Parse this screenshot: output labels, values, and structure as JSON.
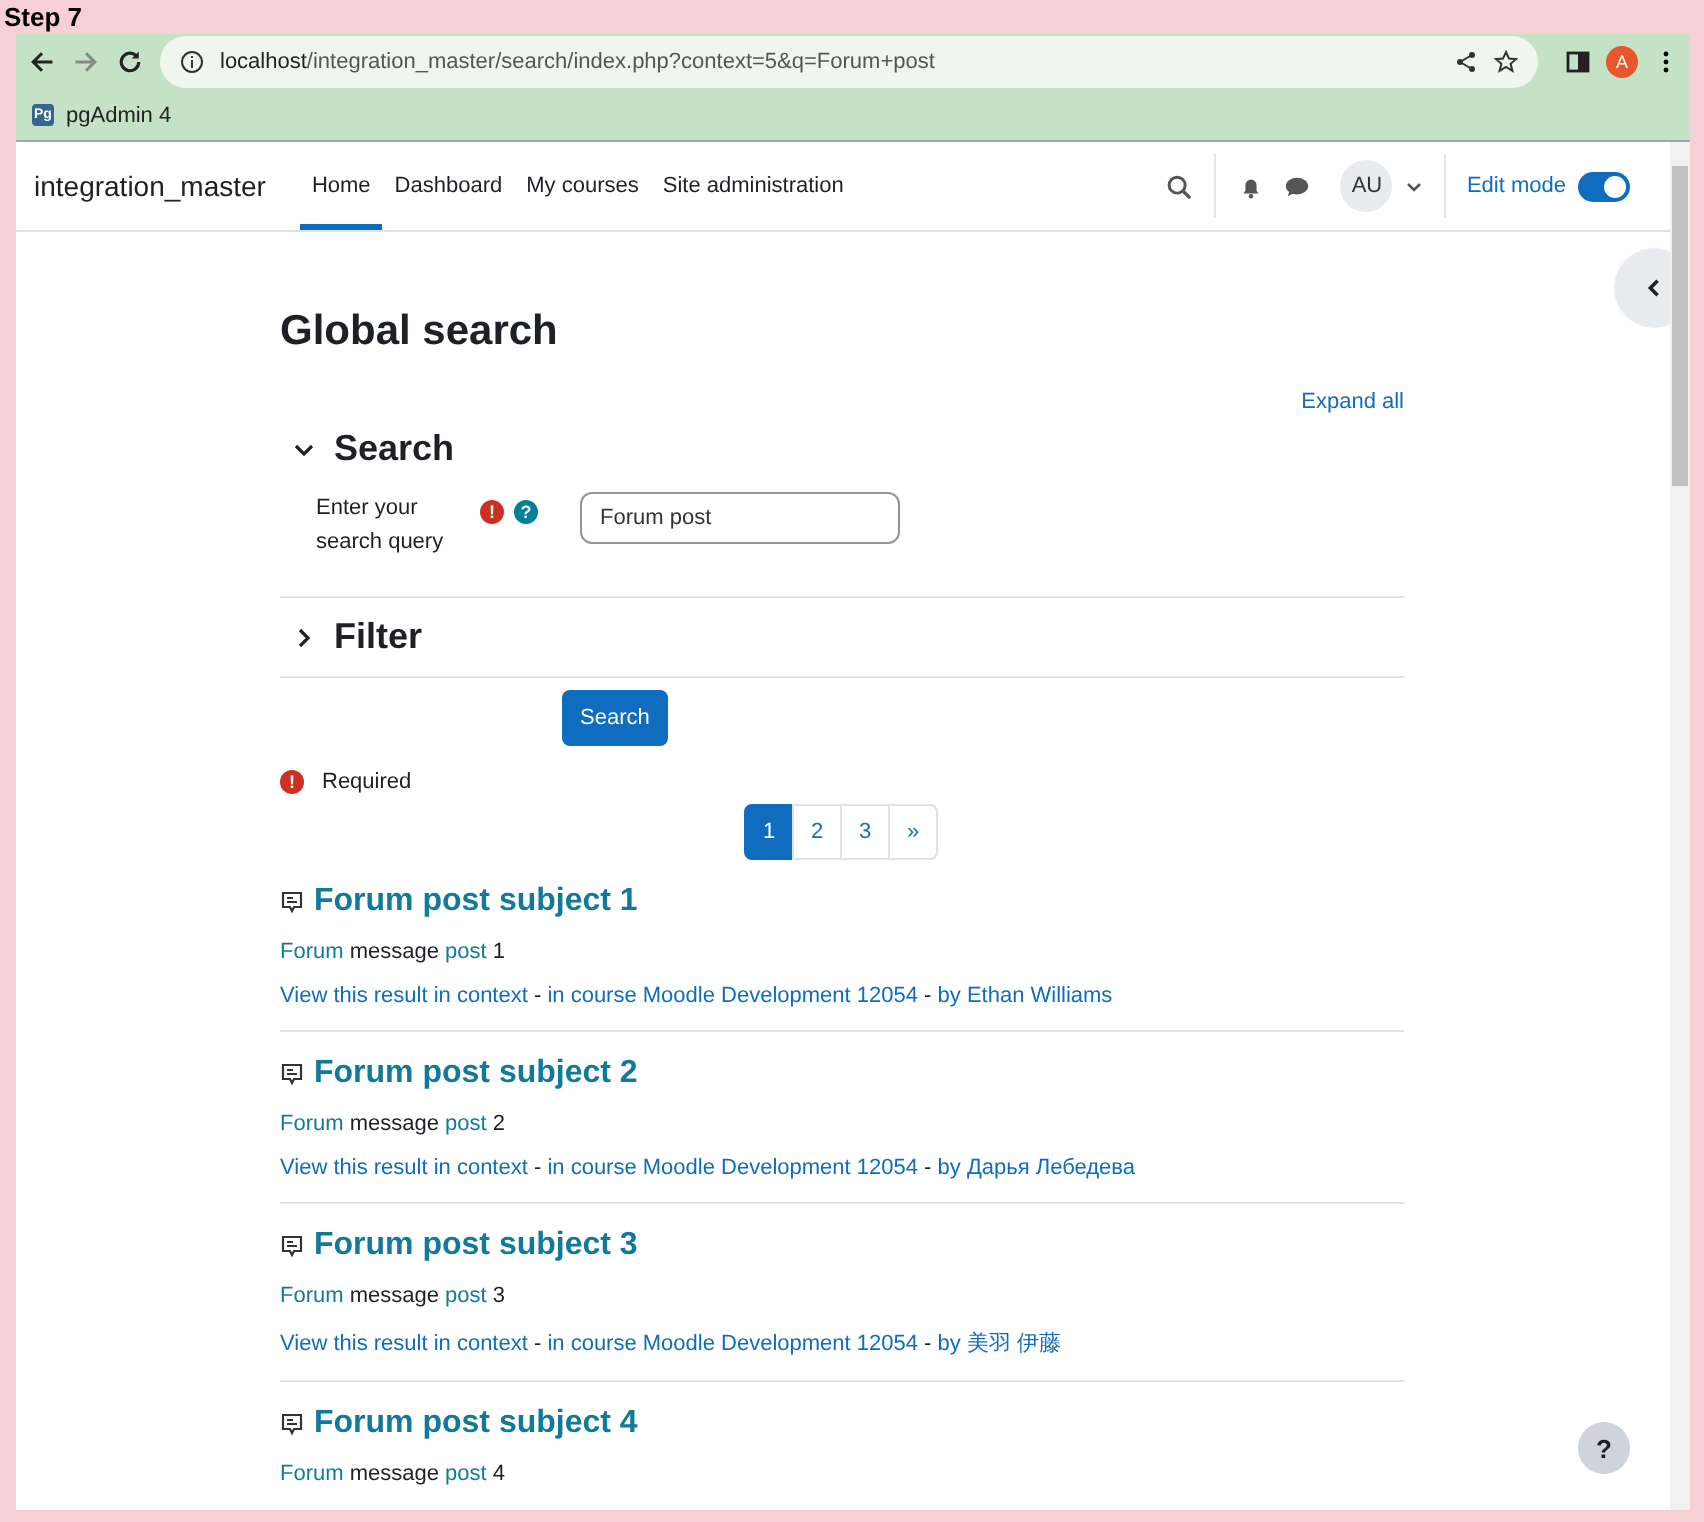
{
  "caption": "Step 7",
  "browser": {
    "url_host": "localhost",
    "url_path": "/integration_master/search/index.php?context=5&q=Forum+post",
    "profile": "A",
    "bookmarks": [
      {
        "label": "pgAdmin 4",
        "icon": "Pg"
      }
    ]
  },
  "navbar": {
    "site_name": "integration_master",
    "links": [
      {
        "label": "Home",
        "selected": true
      },
      {
        "label": "Dashboard",
        "selected": false
      },
      {
        "label": "My courses",
        "selected": false
      },
      {
        "label": "Site administration",
        "selected": false
      }
    ],
    "user_initials": "AU",
    "edit_mode": {
      "label": "Edit mode",
      "on": true
    }
  },
  "page": {
    "title": "Global search",
    "expand_all": "Expand all",
    "sections": [
      {
        "title": "Search",
        "expanded": true
      },
      {
        "title": "Filter",
        "expanded": false
      }
    ],
    "query_label": "Enter your search query",
    "query_value": "Forum post",
    "required_icon": "!",
    "help_icon": "?",
    "search_button": "Search",
    "required_note": "Required",
    "pages": [
      {
        "label": "1",
        "selected": true
      },
      {
        "label": "2",
        "selected": false
      },
      {
        "label": "3",
        "selected": false
      },
      {
        "label": "»",
        "selected": false
      }
    ],
    "results": [
      {
        "title": "Forum post subject 1",
        "message": [
          {
            "text": "Forum",
            "hit": true
          },
          {
            "text": " message ",
            "hit": false
          },
          {
            "text": "post",
            "hit": true
          },
          {
            "text": " 1",
            "hit": false
          }
        ],
        "context": [
          {
            "text": "View this result in context",
            "link": true
          },
          {
            "text": " - ",
            "link": false
          },
          {
            "text": "in course Moodle Development 12054",
            "link": true
          },
          {
            "text": " - ",
            "link": false
          },
          {
            "text": "by Ethan Williams",
            "link": true
          }
        ]
      },
      {
        "title": "Forum post subject 2",
        "message": [
          {
            "text": "Forum",
            "hit": true
          },
          {
            "text": " message ",
            "hit": false
          },
          {
            "text": "post",
            "hit": true
          },
          {
            "text": " 2",
            "hit": false
          }
        ],
        "context": [
          {
            "text": "View this result in context",
            "link": true
          },
          {
            "text": " - ",
            "link": false
          },
          {
            "text": "in course Moodle Development 12054",
            "link": true
          },
          {
            "text": " - ",
            "link": false
          },
          {
            "text": "by Дарья Лебедева",
            "link": true
          }
        ]
      },
      {
        "title": "Forum post subject 3",
        "message": [
          {
            "text": "Forum",
            "hit": true
          },
          {
            "text": " message ",
            "hit": false
          },
          {
            "text": "post",
            "hit": true
          },
          {
            "text": " 3",
            "hit": false
          }
        ],
        "context": [
          {
            "text": "View this result in context",
            "link": true
          },
          {
            "text": " - ",
            "link": false
          },
          {
            "text": "in course Moodle Development 12054",
            "link": true
          },
          {
            "text": " - ",
            "link": false
          },
          {
            "text": "by 美羽 伊藤",
            "link": true
          }
        ]
      },
      {
        "title": "Forum post subject 4",
        "message": [
          {
            "text": "Forum",
            "hit": true
          },
          {
            "text": " message ",
            "hit": false
          },
          {
            "text": "post",
            "hit": true
          },
          {
            "text": " 4",
            "hit": false
          }
        ]
      }
    ],
    "help_button": "?"
  }
}
